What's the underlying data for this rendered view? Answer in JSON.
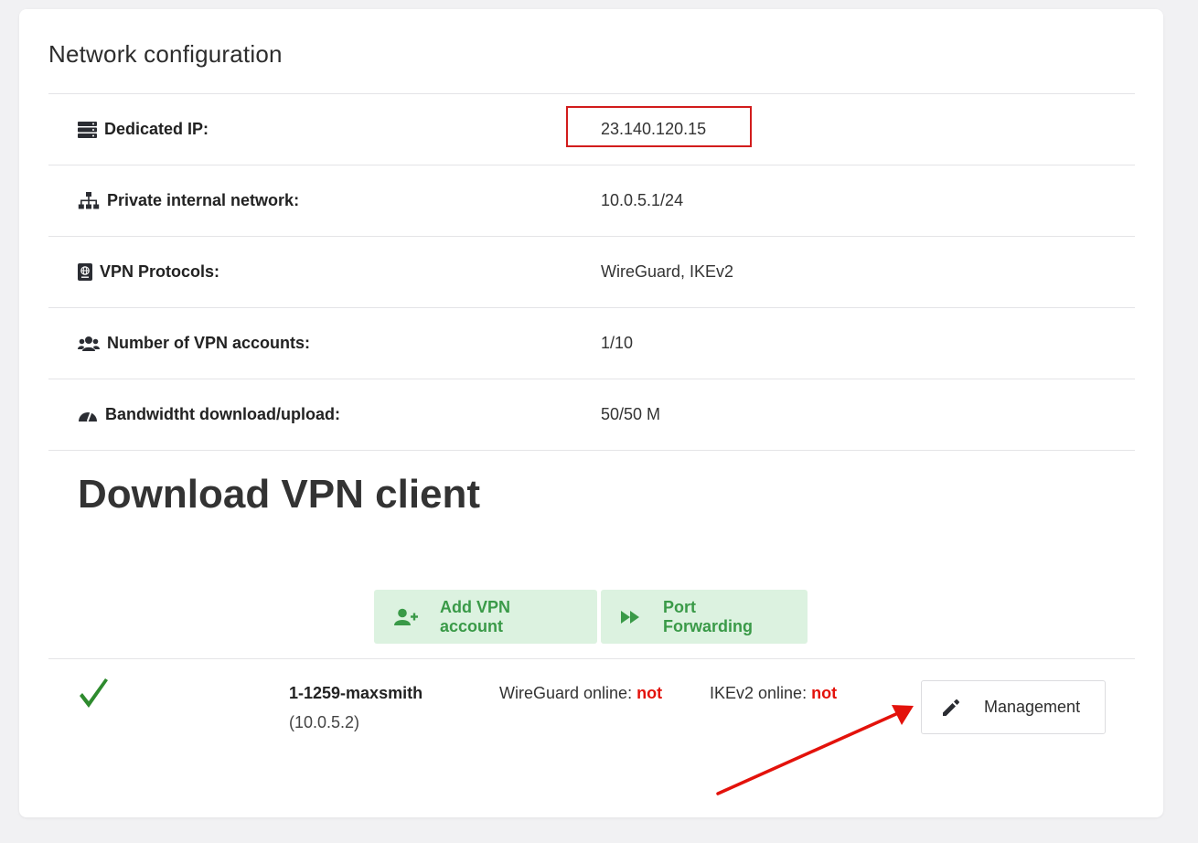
{
  "card": {
    "title": "Network configuration"
  },
  "config": [
    {
      "icon": "server-icon",
      "label": "Dedicated IP:",
      "value": "23.140.120.15"
    },
    {
      "icon": "network-icon",
      "label": "Private internal network:",
      "value": "10.0.5.1/24"
    },
    {
      "icon": "passport-icon",
      "label": "VPN Protocols:",
      "value": "WireGuard, IKEv2"
    },
    {
      "icon": "users-icon",
      "label": "Number of VPN accounts:",
      "value": "1/10"
    },
    {
      "icon": "speedometer-icon",
      "label": "Bandwidtht download/upload:",
      "value": "50/50 M"
    }
  ],
  "download": {
    "heading": "Download VPN client"
  },
  "actions": {
    "add_account_label": "Add VPN account",
    "port_forwarding_label": "Port Forwarding"
  },
  "account": {
    "status_icon": "checkmark-icon",
    "name": "1-1259-maxsmith",
    "ip": "(10.0.5.2)",
    "wireguard_label": "WireGuard online: ",
    "wireguard_value": "not",
    "ikev2_label": "IKEv2 online: ",
    "ikev2_value": "not",
    "manage_label": "Management"
  },
  "colors": {
    "accent_green": "#3a9a48",
    "button_green_bg": "#dcf2e0",
    "status_red": "#e3120b",
    "highlight_red": "#d21c1c"
  }
}
